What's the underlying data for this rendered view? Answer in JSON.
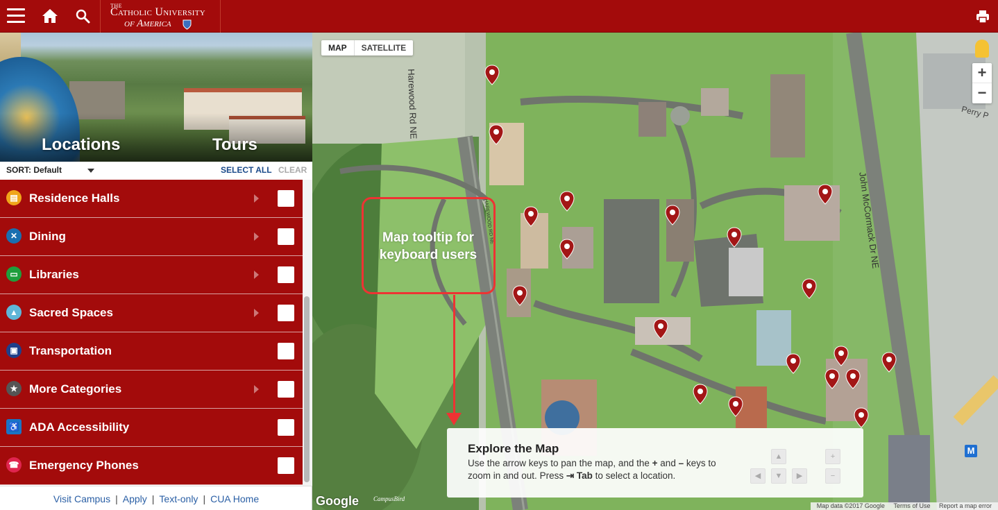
{
  "header": {
    "logo_line1": "THE",
    "logo_line2": "Catholic University",
    "logo_line3": "of America"
  },
  "hero": {
    "tab_locations": "Locations",
    "tab_tours": "Tours"
  },
  "sortbar": {
    "sort_label": "SORT:",
    "sort_value": "Default",
    "select_all": "SELECT ALL",
    "clear": "CLEAR"
  },
  "categories": [
    {
      "label": "Residence Halls",
      "icon": "building-icon",
      "color": "#f0a51a",
      "has_submenu": true
    },
    {
      "label": "Dining",
      "icon": "fork-knife-icon",
      "color": "#1a6fb0",
      "has_submenu": true
    },
    {
      "label": "Libraries",
      "icon": "book-icon",
      "color": "#1f9e3c",
      "has_submenu": true
    },
    {
      "label": "Sacred Spaces",
      "icon": "chapel-icon",
      "color": "#5fb6d8",
      "has_submenu": true
    },
    {
      "label": "Transportation",
      "icon": "bus-icon",
      "color": "#1f3f8a",
      "has_submenu": false
    },
    {
      "label": "More Categories",
      "icon": "star-icon",
      "color": "#555555",
      "has_submenu": true
    },
    {
      "label": "ADA Accessibility",
      "icon": "wheelchair-icon",
      "color": "#1b74c4",
      "has_submenu": false
    },
    {
      "label": "Emergency Phones",
      "icon": "phone-icon",
      "color": "#e0254f",
      "has_submenu": false
    }
  ],
  "footer": {
    "links": [
      "Visit Campus",
      "Apply",
      "Text-only",
      "CUA Home"
    ]
  },
  "map": {
    "map_button": "MAP",
    "satellite_button": "SATELLITE",
    "zoom_in": "+",
    "zoom_out": "−",
    "road_harewood": "Harewood Rd NE",
    "road_mccormack": "John McCormack Dr NE",
    "road_perry": "Perry P",
    "annotation": "Map tooltip for keyboard users",
    "explore_title": "Explore the Map",
    "explore_text_1": "Use the arrow keys to pan the map, and the ",
    "explore_plus": "+",
    "explore_and": " and ",
    "explore_minus": "–",
    "explore_text_2": " keys to zoom in and out. Press ",
    "explore_tab_icon": "⇥",
    "explore_tab": "Tab",
    "explore_text_3": " to select a location.",
    "google": "Google",
    "campusbird": "CampusBird",
    "map_data": "Map data ©2017 Google",
    "terms": "Terms of Use",
    "report": "Report a map error",
    "metro": "M"
  },
  "colors": {
    "brand_red": "#a30b0b",
    "link_blue": "#1a4a8a",
    "annotation_red": "#ee3333"
  }
}
